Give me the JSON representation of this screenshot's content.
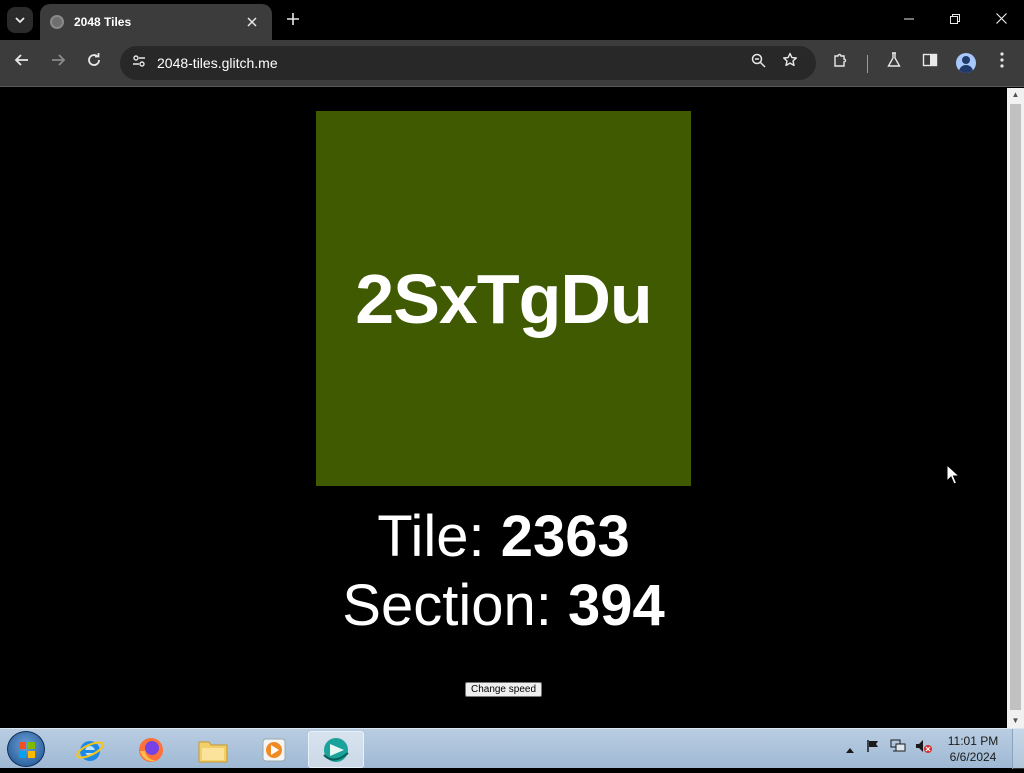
{
  "browser": {
    "tab_title": "2048 Tiles",
    "url": "2048-tiles.glitch.me"
  },
  "page": {
    "tile_text": "2SxTgDu",
    "tile_color": "#3f5a00",
    "tile_label": "Tile: ",
    "tile_number": "2363",
    "section_label": "Section: ",
    "section_number": "394",
    "change_speed_label": "Change speed"
  },
  "taskbar": {
    "apps": [
      "internet-explorer",
      "firefox",
      "file-explorer",
      "media-player",
      "active-app"
    ],
    "time": "11:01 PM",
    "date": "6/6/2024"
  }
}
